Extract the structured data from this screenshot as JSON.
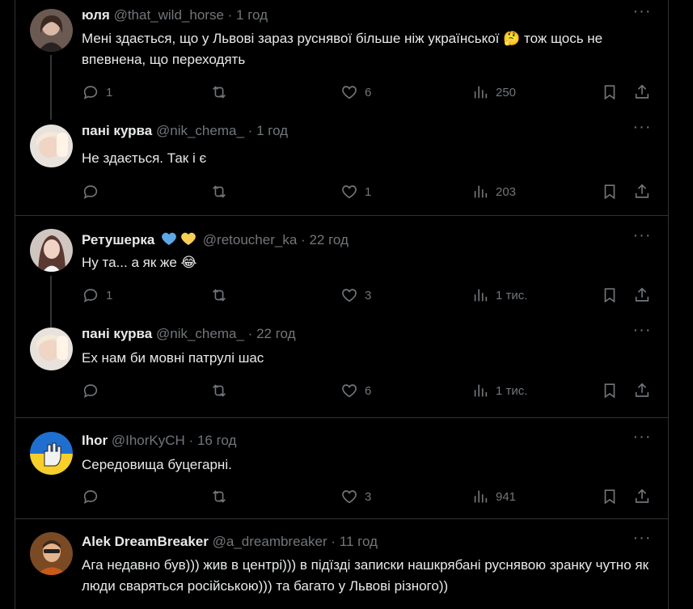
{
  "tweets": [
    {
      "name": "юля",
      "handle": "@that_wild_horse",
      "sep": "·",
      "time": "1 год",
      "text": "Мені здається,  що у Львові зараз руснявої більше ніж української 🤔 тож щось не впевнена, що переходять",
      "replies": "1",
      "retweets": "",
      "likes": "6",
      "views": "250",
      "emoji_badges": [],
      "thread_continues": true
    },
    {
      "name": "пані курва",
      "handle": "@nik_chema_",
      "sep": "·",
      "time": "1 год",
      "text": "Не здається. Так і є",
      "replies": "",
      "retweets": "",
      "likes": "1",
      "views": "203",
      "emoji_badges": [],
      "thread_continues": false
    },
    {
      "name": "Ретушерка",
      "handle": "@retoucher_ka",
      "sep": "·",
      "time": "22 год",
      "text": "Ну та... а як же 😂",
      "replies": "1",
      "retweets": "",
      "likes": "3",
      "views": "1 тис.",
      "emoji_badges": [
        "💙",
        "💛"
      ],
      "thread_continues": true
    },
    {
      "name": "пані курва",
      "handle": "@nik_chema_",
      "sep": "·",
      "time": "22 год",
      "text": "Ех нам би мовні патрулі шас",
      "replies": "",
      "retweets": "",
      "likes": "6",
      "views": "1 тис.",
      "emoji_badges": [],
      "thread_continues": false
    },
    {
      "name": "Ihor",
      "handle": "@IhorKyCH",
      "sep": "·",
      "time": "16 год",
      "text": "Середовища буцегарні.",
      "replies": "",
      "retweets": "",
      "likes": "3",
      "views": "941",
      "emoji_badges": [],
      "thread_continues": false
    },
    {
      "name": "Alek DreamBreaker",
      "handle": "@a_dreambreaker",
      "sep": "·",
      "time": "11 год",
      "text": "Ага недавно був))) жив в центрі))) в підїзді записки нашкрябані руснявою зранку чутно як люди сваряться російською))) та багато у Львові різного))",
      "replies": "",
      "retweets": "",
      "likes": "",
      "views": "",
      "emoji_badges": [],
      "thread_continues": false
    }
  ],
  "icons": {
    "more": "more-horizontal-icon",
    "reply": "reply-bubble-icon",
    "retweet": "retweet-arrows-icon",
    "like": "heart-icon",
    "views": "bar-chart-icon",
    "bookmark": "bookmark-icon",
    "share": "share-upload-icon"
  },
  "colors": {
    "background": "#000000",
    "text": "#e7e9ea",
    "secondary": "#71767b",
    "divider": "#2f3336",
    "thread_line": "#333639"
  }
}
